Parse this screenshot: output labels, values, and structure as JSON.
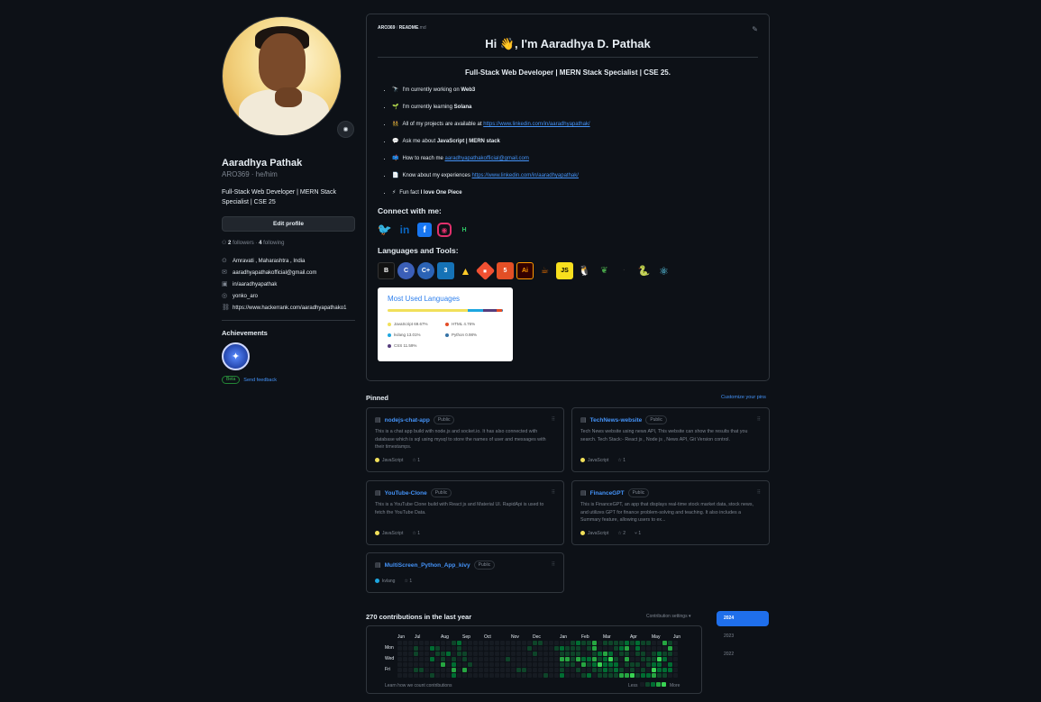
{
  "profile": {
    "name": "Aaradhya Pathak",
    "handle": "ARO369 · he/him",
    "bio": "Full-Stack Web Developer | MERN Stack Specialist | CSE 25",
    "edit_button": "Edit profile",
    "followers_count": "2",
    "followers_label": "followers",
    "following_count": "4",
    "following_label": "following",
    "location": "Amravati , Maharashtra , India",
    "email": "aaradhyapathakofficial@gmail.com",
    "linkedin": "in/aaradhyapathak",
    "instagram": "yonko_aro",
    "website": "https://www.hackerrank.com/aaradhyapathako1",
    "achievements_title": "Achievements",
    "beta_label": "Beta",
    "feedback_label": "Send feedback"
  },
  "readme": {
    "path_user": "ARO369",
    "path_sep": " / ",
    "path_file": "README",
    "path_ext": ".md",
    "greeting": "Hi 👋, I'm Aaradhya D. Pathak",
    "subtitle": "Full-Stack Web Developer | MERN Stack Specialist | CSE 25.",
    "bullets": [
      {
        "emoji": "🔭",
        "text": "I'm currently working on ",
        "bold": "Web3",
        "link": ""
      },
      {
        "emoji": "🌱",
        "text": "I'm currently learning ",
        "bold": "Solana",
        "link": ""
      },
      {
        "emoji": "👯",
        "text": "All of my projects are available at ",
        "bold": "",
        "link": "https://www.linkedin.com/in/aaradhyapathak/"
      },
      {
        "emoji": "💬",
        "text": "Ask me about ",
        "bold": "JavaScript | MERN stack",
        "link": ""
      },
      {
        "emoji": "📫",
        "text": "How to reach me ",
        "bold": "",
        "link": "aaradhyapathakofficial@gmail.com"
      },
      {
        "emoji": "📄",
        "text": "Know about my experiences ",
        "bold": "",
        "link": "https://www.linkedin.com/in/aaradhyapathak/"
      },
      {
        "emoji": "⚡",
        "text": "Fun fact ",
        "bold": "I love One Piece",
        "link": ""
      }
    ],
    "connect_title": "Connect with me:",
    "tools_title": "Languages and Tools:",
    "lang_card": {
      "title": "Most Used Languages",
      "items": [
        {
          "name": "JavaScript 69.67%",
          "color": "#f1e05a",
          "pct": 69.67
        },
        {
          "name": "HTML 4.76%",
          "color": "#e34c26",
          "pct": 4.76
        },
        {
          "name": "kvlang 13.01%",
          "color": "#1da6e0",
          "pct": 13.01
        },
        {
          "name": "Python 0.98%",
          "color": "#3572A5",
          "pct": 0.98
        },
        {
          "name": "CSS 11.59%",
          "color": "#563d7c",
          "pct": 11.59
        }
      ]
    }
  },
  "pinned": {
    "title": "Pinned",
    "customize": "Customize your pins",
    "repos": [
      {
        "name": "nodejs-chat-app",
        "visibility": "Public",
        "desc": "This is a chat app build with node.js and socket.io. It has also connected with database which is sql using mysql to store the names of user and messages with their timestamps.",
        "lang": "JavaScript",
        "lang_color": "#f1e05a",
        "stars": "1",
        "forks": ""
      },
      {
        "name": "TechNews-website",
        "visibility": "Public",
        "desc": "Tech News website using news API, This website can show the results that you search. Tech Stack:- React js , Node js , News API, Git Version control.",
        "lang": "JavaScript",
        "lang_color": "#f1e05a",
        "stars": "1",
        "forks": ""
      },
      {
        "name": "YouTube-Clone",
        "visibility": "Public",
        "desc": "This is a YouTube Clone build with React js and Material UI. RapidApi is used to fetch the YouTube Data.",
        "lang": "JavaScript",
        "lang_color": "#f1e05a",
        "stars": "1",
        "forks": ""
      },
      {
        "name": "FinanceGPT",
        "visibility": "Public",
        "desc": "This is FinanceGPT, an app that displays real-time stock market data, stock news, and utilizes GPT for finance problem-solving and teaching. It also includes a Summary feature, allowing users to ex...",
        "lang": "JavaScript",
        "lang_color": "#f1e05a",
        "stars": "2",
        "forks": "1"
      },
      {
        "name": "MultiScreen_Python_App_kivy",
        "visibility": "Public",
        "desc": "",
        "lang": "kvlang",
        "lang_color": "#1da6e0",
        "stars": "1",
        "forks": ""
      }
    ]
  },
  "contributions": {
    "title": "270 contributions in the last year",
    "settings": "Contribution settings ▾",
    "months": [
      "Jun",
      "Jul",
      "Aug",
      "Sep",
      "Oct",
      "Nov",
      "Dec",
      "Jan",
      "Feb",
      "Mar",
      "Apr",
      "May",
      "Jun"
    ],
    "days": [
      "Mon",
      "Wed",
      "Fri"
    ],
    "learn": "Learn how we count contributions",
    "less": "Less",
    "more": "More",
    "years": [
      "2024",
      "2023",
      "2022"
    ]
  }
}
